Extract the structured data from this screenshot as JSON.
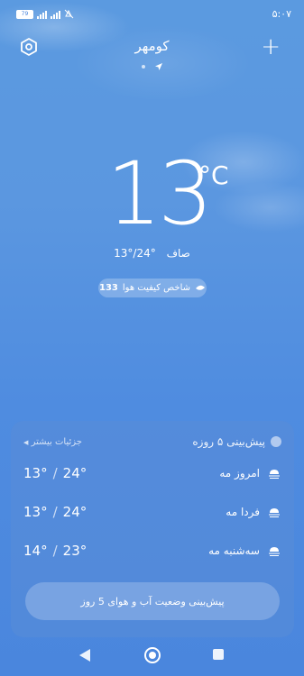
{
  "status_bar": {
    "battery": "79",
    "network_label": "4G",
    "time": "۵:۰۷"
  },
  "header": {
    "city": "کومهر",
    "settings_icon": "gear-icon",
    "add_label": "+"
  },
  "current": {
    "temperature": "13",
    "unit": "°C",
    "condition": "صاف",
    "range": "13°/24°"
  },
  "aqi": {
    "label": "شاخص کیفیت هوا",
    "value": "133"
  },
  "forecast": {
    "title": "پیش‌بینی ۵ روزه",
    "more_link": "جزئیات بیشتر",
    "days": [
      {
        "day": "امروز مه",
        "high": "24°",
        "low": "13°"
      },
      {
        "day": "فردا مه",
        "high": "24°",
        "low": "13°"
      },
      {
        "day": "سه‌شنبه مه",
        "high": "23°",
        "low": "14°"
      }
    ],
    "cta_label": "پیش‌بینی وضعیت آب و هوای 5 روز"
  }
}
